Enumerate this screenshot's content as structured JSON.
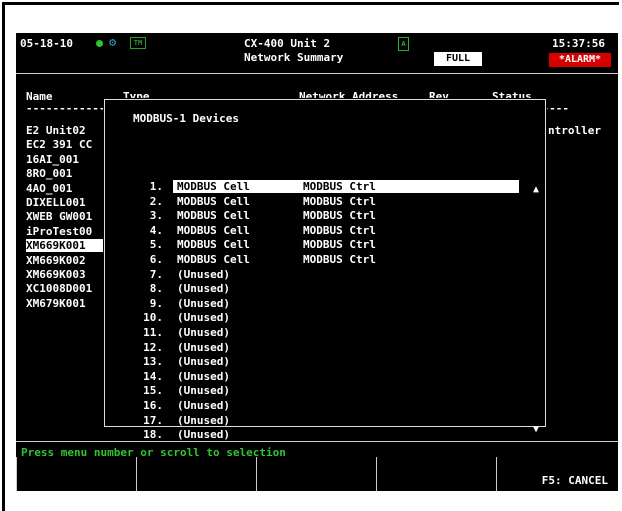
{
  "header": {
    "date": "05-18-10",
    "unit_name": "CX-400 Unit 2",
    "screen_title": "Network Summary",
    "time": "15:37:56",
    "full_badge": "FULL",
    "alarm_badge": "*ALARM*",
    "status_color": "#31c431",
    "alarm_color": "#d50000"
  },
  "columns": {
    "name": "Name",
    "type": "Type",
    "network_address": "Network Address",
    "rev": "Rev",
    "status": "Status",
    "dashes": "----------------------------------------------------------------------------------"
  },
  "network_names": [
    "E2 Unit02",
    "EC2 391 CC",
    "16AI_001",
    "8RO_001",
    "4AO_001",
    "DIXELL001",
    "XWEB GW001",
    "iProTest00",
    "XM669K001",
    "XM669K002",
    "XM669K003",
    "XC1008D001",
    "XM679K001"
  ],
  "selected_network_index": 8,
  "right_column_text": "ntroller",
  "popup": {
    "title": "MODBUS-1 Devices",
    "devices": [
      {
        "num": "1.",
        "name": "MODBUS Cell",
        "type": "MODBUS Ctrl"
      },
      {
        "num": "2.",
        "name": "MODBUS Cell",
        "type": "MODBUS Ctrl"
      },
      {
        "num": "3.",
        "name": "MODBUS Cell",
        "type": "MODBUS Ctrl"
      },
      {
        "num": "4.",
        "name": "MODBUS Cell",
        "type": "MODBUS Ctrl"
      },
      {
        "num": "5.",
        "name": "MODBUS Cell",
        "type": "MODBUS Ctrl"
      },
      {
        "num": "6.",
        "name": "MODBUS Cell",
        "type": "MODBUS Ctrl"
      },
      {
        "num": "7.",
        "name": "(Unused)",
        "type": ""
      },
      {
        "num": "8.",
        "name": "(Unused)",
        "type": ""
      },
      {
        "num": "9.",
        "name": "(Unused)",
        "type": ""
      },
      {
        "num": "10.",
        "name": "(Unused)",
        "type": ""
      },
      {
        "num": "11.",
        "name": "(Unused)",
        "type": ""
      },
      {
        "num": "12.",
        "name": "(Unused)",
        "type": ""
      },
      {
        "num": "13.",
        "name": "(Unused)",
        "type": ""
      },
      {
        "num": "14.",
        "name": "(Unused)",
        "type": ""
      },
      {
        "num": "15.",
        "name": "(Unused)",
        "type": ""
      },
      {
        "num": "16.",
        "name": "(Unused)",
        "type": ""
      },
      {
        "num": "17.",
        "name": "(Unused)",
        "type": ""
      },
      {
        "num": "18.",
        "name": "(Unused)",
        "type": ""
      }
    ],
    "selected_index": 0,
    "scroll_up_icon": "triangle-up-icon",
    "scroll_down_icon": "triangle-down-icon"
  },
  "footer": {
    "prompt": "Press menu number or scroll to selection",
    "prompt_color": "#31c431",
    "softkeys": [
      "",
      "",
      "",
      "",
      "F5: CANCEL"
    ]
  }
}
